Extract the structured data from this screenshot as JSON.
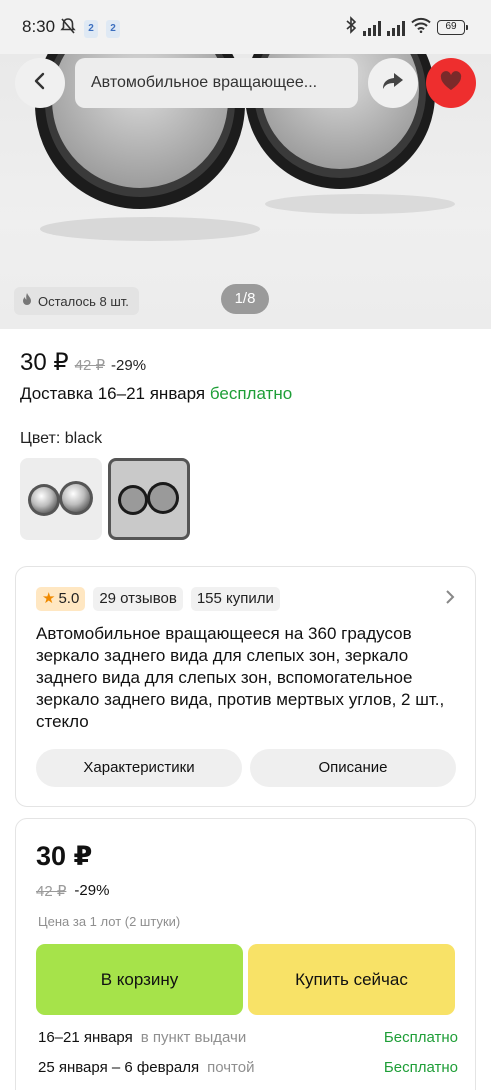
{
  "status_bar": {
    "time": "8:30",
    "badge_1": "2",
    "badge_2": "2",
    "battery": "69"
  },
  "header": {
    "search_text": "Автомобильное вращающее..."
  },
  "gallery": {
    "stock_text": "Осталось 8 шт.",
    "page_indicator": "1/8"
  },
  "price": {
    "current": "30 ₽",
    "old": "42 ₽",
    "discount": "-29%"
  },
  "delivery": {
    "label": "Доставка 16–21 января",
    "free": "бесплатно"
  },
  "color": {
    "label": "Цвет: black",
    "options": [
      "silver",
      "black"
    ],
    "selected": "black"
  },
  "product": {
    "rating": "5.0",
    "reviews": "29 отзывов",
    "bought": "155 купили",
    "title": "Автомобильное вращающееся на 360 градусов зеркало заднего вида для слепых зон, зеркало заднего вида для слепых зон, вспомогательное зеркало заднего вида, против мертвых углов, 2 шт., стекло",
    "specs_label": "Характеристики",
    "description_label": "Описание"
  },
  "buy_box": {
    "price": "30 ₽",
    "old_price": "42 ₽",
    "discount": "-29%",
    "lot_note": "Цена за 1 лот (2 штуки)",
    "cart_button": "В корзину",
    "buy_now_button": "Купить сейчас",
    "shipping": [
      {
        "date": "16–21 января",
        "method": "в пункт выдачи",
        "cost": "Бесплатно"
      },
      {
        "date": "25 января – 6 февраля",
        "method": "почтой",
        "cost": "Бесплатно"
      }
    ]
  },
  "colors": {
    "accent_red": "#ee2e2e",
    "green_text": "#1e9e37",
    "cart_green": "#a6e34a",
    "buy_yellow": "#f8e267"
  },
  "icons": [
    "muted-bell-icon",
    "bluetooth-icon",
    "signal-icon",
    "wifi-icon",
    "battery-icon",
    "back-arrow-icon",
    "share-icon",
    "heart-icon",
    "fire-icon",
    "star-icon",
    "chevron-right-icon"
  ]
}
